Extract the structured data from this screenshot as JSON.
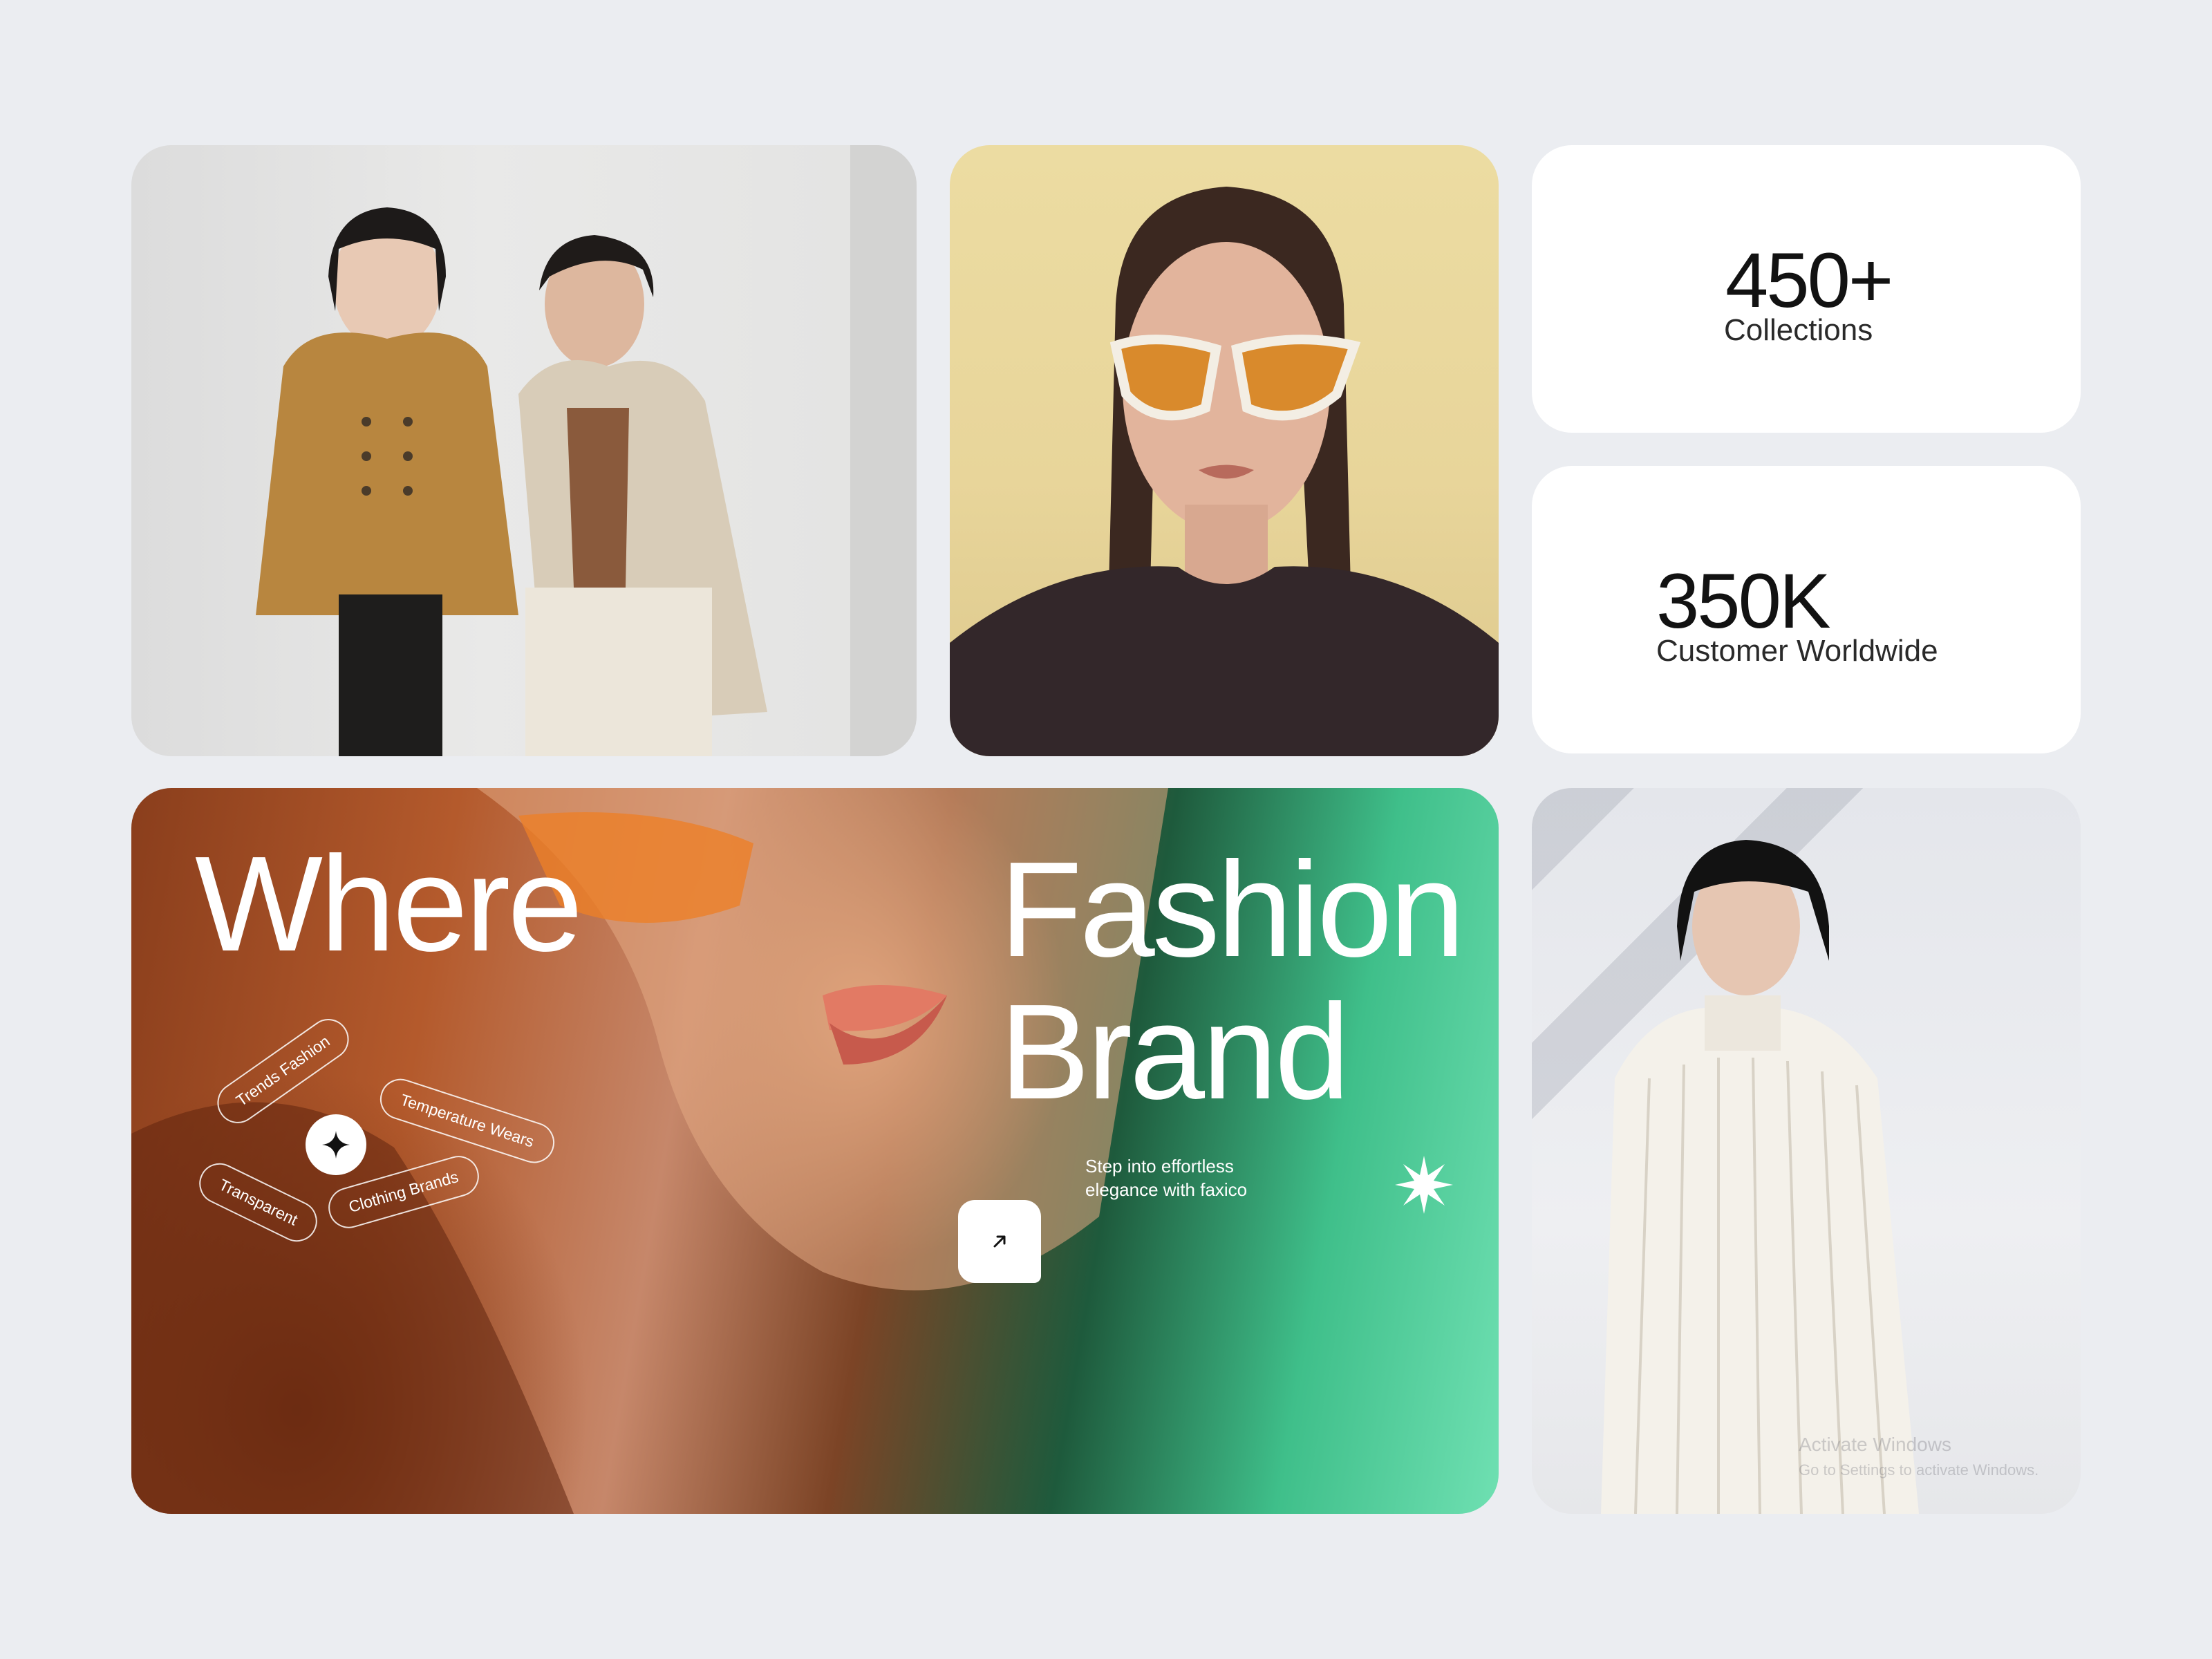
{
  "stats": {
    "collections": {
      "value": "450+",
      "label": "Collections"
    },
    "customers": {
      "value": "350K",
      "label": "Customer Worldwide"
    }
  },
  "hero": {
    "word_1": "Where",
    "word_2": "Fashion",
    "word_3": "Brand",
    "tags": [
      "Trends Fashion",
      "Temperature Wears",
      "Transparent",
      "Clothing Brands"
    ],
    "tagline": "Step into effortless elegance with faxico"
  },
  "photos": {
    "duo": "two-models-trench-coats",
    "sunglasses": "model-orange-sunglasses",
    "knit": "model-white-knit-sweater"
  },
  "watermark": {
    "line1": "Activate Windows",
    "line2": "Go to Settings to activate Windows."
  },
  "icons": {
    "sparkle": "sparkle-icon",
    "arrow": "arrow-up-right-icon",
    "burst": "starburst-icon"
  },
  "colors": {
    "page_bg": "#ebedf1",
    "card_bg": "#ffffff",
    "text_dark": "#121212",
    "hero_green": "#6fe0b2",
    "hero_orange": "#b45a2c"
  }
}
